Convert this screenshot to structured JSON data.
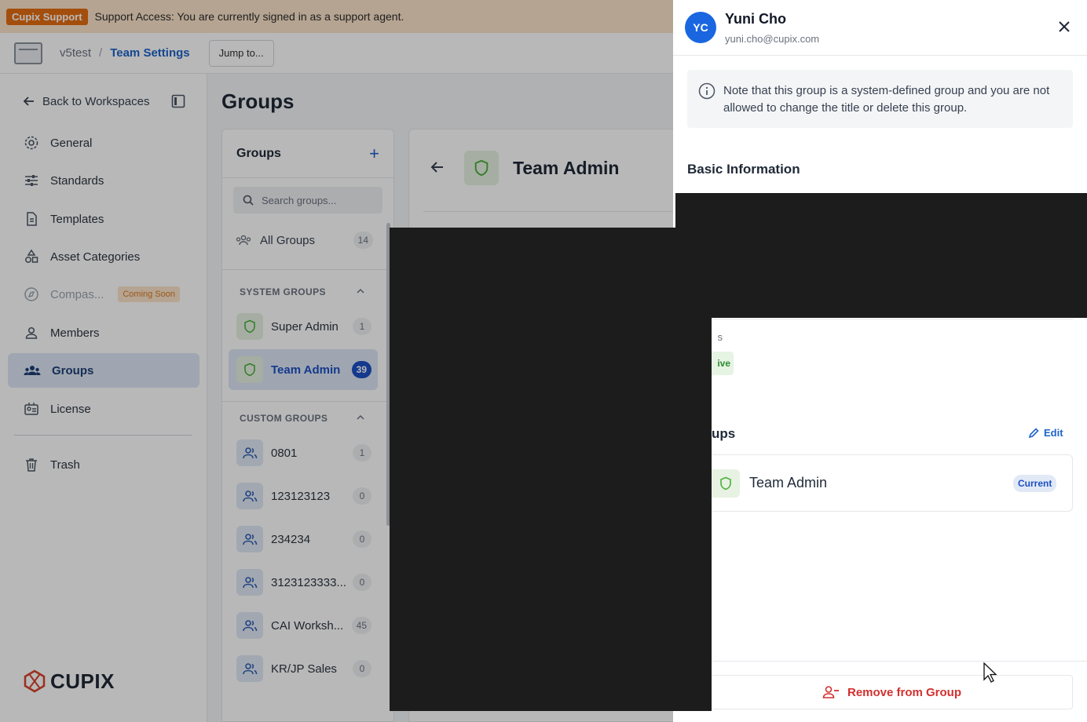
{
  "banner": {
    "tag": "Cupix Support",
    "message": "Support Access: You are currently signed in as a support agent."
  },
  "header": {
    "workspace": "v5test",
    "separator": "/",
    "page": "Team Settings",
    "jump_label": "Jump to..."
  },
  "sidebar": {
    "back_label": "Back to Workspaces",
    "items": [
      {
        "label": "General",
        "icon": "gear-icon"
      },
      {
        "label": "Standards",
        "icon": "sliders-icon"
      },
      {
        "label": "Templates",
        "icon": "document-icon"
      },
      {
        "label": "Asset Categories",
        "icon": "shapes-icon"
      },
      {
        "label": "Compas...",
        "icon": "compass-icon",
        "badge": "Coming Soon"
      },
      {
        "label": "Members",
        "icon": "person-icon"
      },
      {
        "label": "Groups",
        "icon": "people-icon"
      },
      {
        "label": "License",
        "icon": "license-icon"
      },
      {
        "label": "Trash",
        "icon": "trash-icon"
      }
    ],
    "brand": "CUPIX"
  },
  "main": {
    "title": "Groups",
    "groups_panel": {
      "title": "Groups",
      "search_placeholder": "Search groups...",
      "all_groups": {
        "label": "All Groups",
        "count": "14"
      },
      "system_section": "SYSTEM GROUPS",
      "system_groups": [
        {
          "name": "Super Admin",
          "count": "1"
        },
        {
          "name": "Team Admin",
          "count": "39"
        }
      ],
      "custom_section": "CUSTOM GROUPS",
      "custom_groups": [
        {
          "name": "0801",
          "count": "1"
        },
        {
          "name": "123123123",
          "count": "0"
        },
        {
          "name": "234234",
          "count": "0"
        },
        {
          "name": "3123123333...",
          "count": "0"
        },
        {
          "name": "CAI Worksh...",
          "count": "45"
        },
        {
          "name": "KR/JP Sales",
          "count": "0"
        }
      ]
    },
    "detail": {
      "title": "Team Admin"
    }
  },
  "drawer": {
    "avatar_initials": "YC",
    "name": "Yuni Cho",
    "email": "yuni.cho@cupix.com",
    "note": "Note that this group is a system-defined group and you are not allowed to change the title or delete this group.",
    "basic_info": "Basic Information",
    "status_label": "s",
    "status_value": "ive",
    "groups_heading": "ups",
    "edit_label": "Edit",
    "group_card": {
      "name": "Team Admin",
      "badge": "Current"
    },
    "remove_label": "Remove from Group"
  },
  "colors": {
    "accent": "#1d63c9",
    "banner_bg": "#fbe3c9",
    "banner_tag": "#e36d12",
    "danger": "#d32f2f",
    "success": "#2e8b2e"
  }
}
